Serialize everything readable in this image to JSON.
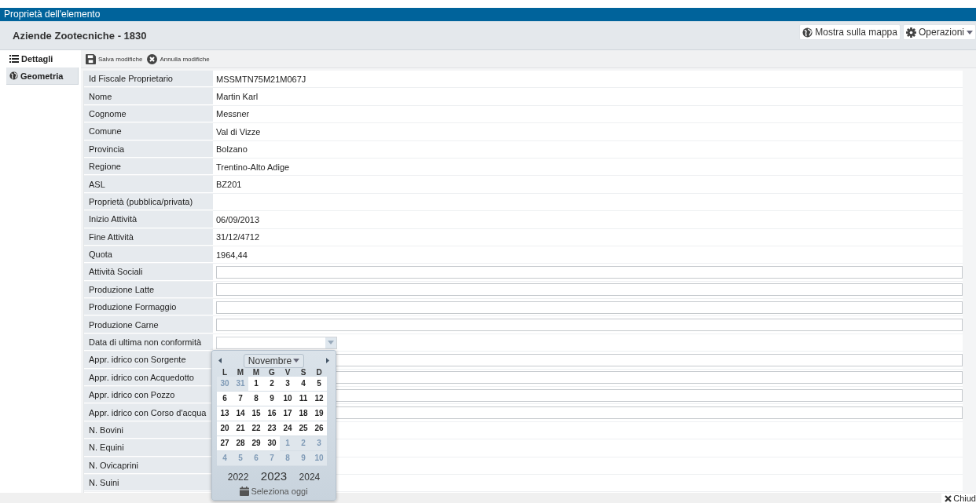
{
  "window": {
    "title": "Proprietà dell'elemento"
  },
  "header": {
    "title": "Aziende Zootecniche - 1830",
    "buttons": [
      {
        "label": "Mostra sulla mappa",
        "kind": "map"
      },
      {
        "label": "Operazioni",
        "kind": "menu"
      }
    ]
  },
  "tabs": [
    {
      "label": "Dettagli",
      "kind": "list",
      "selected": true
    },
    {
      "label": "Geometria",
      "kind": "globe",
      "selected": false
    }
  ],
  "toolbar": [
    {
      "label": "Salva modifiche",
      "kind": "save"
    },
    {
      "label": "Annulla modifiche",
      "kind": "cancel"
    }
  ],
  "fields": [
    {
      "label": "Id Fiscale Proprietario",
      "kind": "text",
      "value": "MSSMTN75M21M067J"
    },
    {
      "label": "Nome",
      "kind": "text",
      "value": "Martin Karl"
    },
    {
      "label": "Cognome",
      "kind": "text",
      "value": "Messner"
    },
    {
      "label": "Comune",
      "kind": "text",
      "value": "Val di Vizze"
    },
    {
      "label": "Provincia",
      "kind": "text",
      "value": "Bolzano"
    },
    {
      "label": "Regione",
      "kind": "text",
      "value": "Trentino-Alto Adige"
    },
    {
      "label": "ASL",
      "kind": "text",
      "value": "BZ201"
    },
    {
      "label": "Proprietà (pubblica/privata)",
      "kind": "text"
    },
    {
      "label": "Inizio Attività",
      "kind": "text",
      "value": "06/09/2013"
    },
    {
      "label": "Fine Attività",
      "kind": "text",
      "value": "31/12/4712"
    },
    {
      "label": "Quota",
      "kind": "text",
      "value": "1964,44"
    },
    {
      "label": "Attività Sociali",
      "kind": "input"
    },
    {
      "label": "Produzione Latte",
      "kind": "input"
    },
    {
      "label": "Produzione Formaggio",
      "kind": "input"
    },
    {
      "label": "Produzione Carne",
      "kind": "input"
    },
    {
      "label": "Data di ultima non conformità",
      "kind": "date"
    },
    {
      "label": "Appr. idrico con Sorgente",
      "kind": "input"
    },
    {
      "label": "Appr. idrico con Acquedotto",
      "kind": "input"
    },
    {
      "label": "Appr. idrico con Pozzo",
      "kind": "input"
    },
    {
      "label": "Appr. idrico con Corso d'acqua",
      "kind": "input"
    },
    {
      "label": "N. Bovini",
      "kind": "text"
    },
    {
      "label": "N. Equini",
      "kind": "text"
    },
    {
      "label": "N. Ovicaprini",
      "kind": "text"
    },
    {
      "label": "N. Suini",
      "kind": "text"
    }
  ],
  "datepicker": {
    "month": "Novembre",
    "weekdays": [
      "L",
      "M",
      "M",
      "G",
      "V",
      "S",
      "D"
    ],
    "weeks": [
      [
        {
          "day": "30",
          "in_month": false
        },
        {
          "day": "31",
          "in_month": false
        },
        {
          "day": "1",
          "in_month": true
        },
        {
          "day": "2",
          "in_month": true
        },
        {
          "day": "3",
          "in_month": true
        },
        {
          "day": "4",
          "in_month": true
        },
        {
          "day": "5",
          "in_month": true
        }
      ],
      [
        {
          "day": "6",
          "in_month": true
        },
        {
          "day": "7",
          "in_month": true
        },
        {
          "day": "8",
          "in_month": true
        },
        {
          "day": "9",
          "in_month": true
        },
        {
          "day": "10",
          "in_month": true
        },
        {
          "day": "11",
          "in_month": true
        },
        {
          "day": "12",
          "in_month": true
        }
      ],
      [
        {
          "day": "13",
          "in_month": true
        },
        {
          "day": "14",
          "in_month": true
        },
        {
          "day": "15",
          "in_month": true
        },
        {
          "day": "16",
          "in_month": true
        },
        {
          "day": "17",
          "in_month": true
        },
        {
          "day": "18",
          "in_month": true
        },
        {
          "day": "19",
          "in_month": true
        }
      ],
      [
        {
          "day": "20",
          "in_month": true
        },
        {
          "day": "21",
          "in_month": true
        },
        {
          "day": "22",
          "in_month": true
        },
        {
          "day": "23",
          "in_month": true
        },
        {
          "day": "24",
          "in_month": true
        },
        {
          "day": "25",
          "in_month": true
        },
        {
          "day": "26",
          "in_month": true
        }
      ],
      [
        {
          "day": "27",
          "in_month": true
        },
        {
          "day": "28",
          "in_month": true
        },
        {
          "day": "29",
          "in_month": true
        },
        {
          "day": "30",
          "in_month": true
        },
        {
          "day": "1",
          "in_month": false
        },
        {
          "day": "2",
          "in_month": false
        },
        {
          "day": "3",
          "in_month": false
        }
      ],
      [
        {
          "day": "4",
          "in_month": false
        },
        {
          "day": "5",
          "in_month": false
        },
        {
          "day": "6",
          "in_month": false
        },
        {
          "day": "7",
          "in_month": false
        },
        {
          "day": "8",
          "in_month": false
        },
        {
          "day": "9",
          "in_month": false
        },
        {
          "day": "10",
          "in_month": false
        }
      ]
    ],
    "years": [
      {
        "label": "2022",
        "selected": false
      },
      {
        "label": "2023",
        "selected": true
      },
      {
        "label": "2024",
        "selected": false
      }
    ],
    "today": "Seleziona oggi"
  },
  "footer": {
    "button": "Chiud"
  }
}
